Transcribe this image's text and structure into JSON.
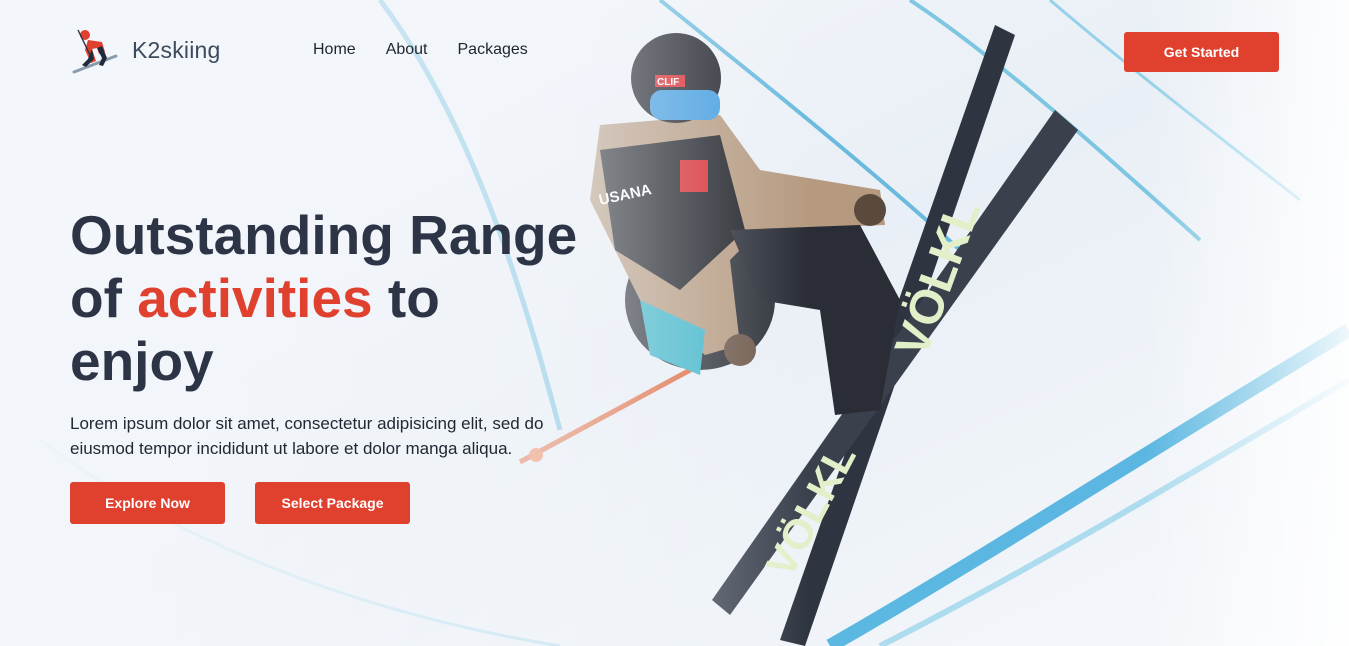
{
  "brand": {
    "name": "K2skiing",
    "accent_color": "#e0412f",
    "heading_color": "#2d3446"
  },
  "nav": {
    "links": [
      "Home",
      "About",
      "Packages"
    ],
    "cta_label": "Get Started"
  },
  "hero": {
    "title_part1": "Outstanding Range",
    "title_part2": "of ",
    "title_accent": "activities",
    "title_part3": " to",
    "title_part4": "enjoy",
    "description": "Lorem ipsum dolor sit amet, consectetur adipisicing elit, sed do eiusmod tempor incididunt ut labore et dolor manga aliqua.",
    "primary_button": "Explore Now",
    "secondary_button": "Select Package",
    "image": "skier-halfpipe-jump",
    "skier_helmet_text": "CLIF",
    "skier_bib_text": "USANA",
    "ski_brand": "VÖLKL"
  },
  "icons": {
    "logo": "skier-logo-icon"
  }
}
